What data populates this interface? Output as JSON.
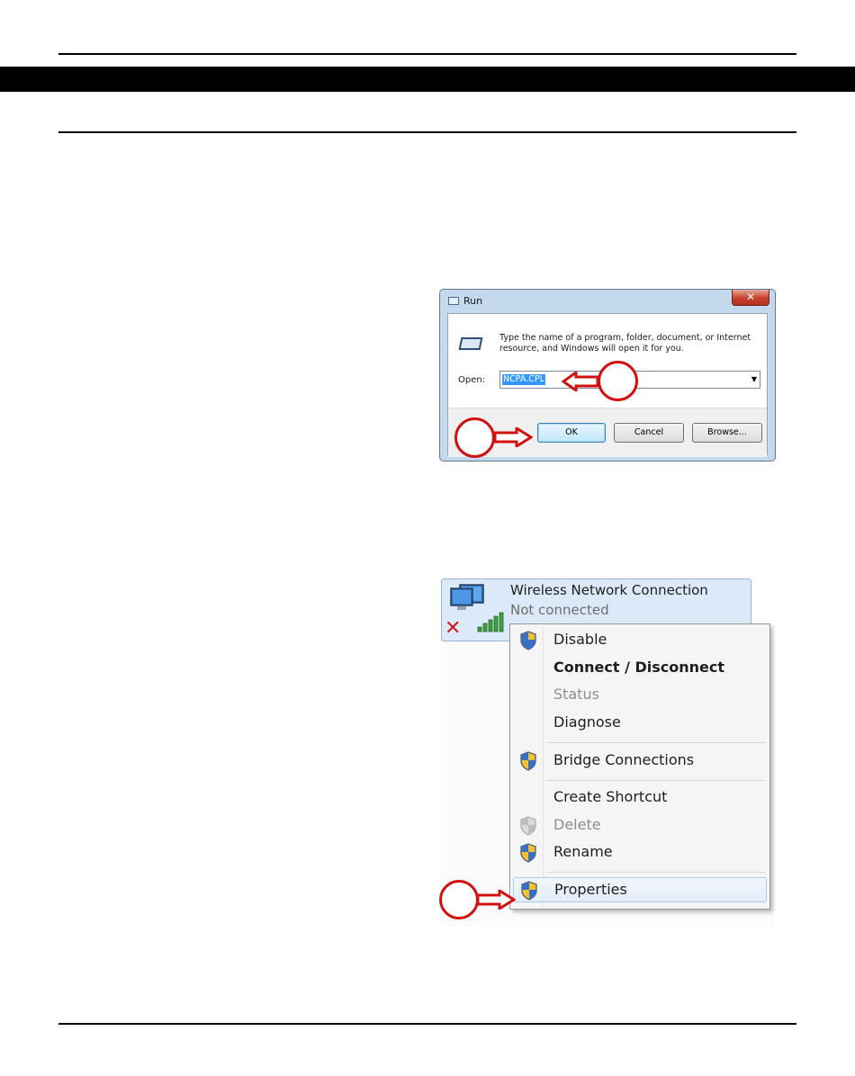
{
  "run_dialog": {
    "title": "Run",
    "description": "Type the name of a program, folder, document, or Internet resource, and Windows will open it for you.",
    "open_label": "Open:",
    "open_value": "NCPA.CPL",
    "buttons": {
      "ok": "OK",
      "cancel": "Cancel",
      "browse": "Browse..."
    },
    "icons": {
      "title": "run-icon",
      "app": "run-program-icon",
      "close": "close-icon",
      "dropdown": "chevron-down-icon"
    }
  },
  "network": {
    "connection_name": "Wireless Network Connection",
    "connection_status": "Not connected",
    "icons": {
      "adapter": "network-adapter-icon",
      "status": "red-x-icon",
      "signal": "signal-bars-icon"
    }
  },
  "context_menu": {
    "items": [
      {
        "label": "Disable",
        "style": "normal",
        "shield": "uac-shield-icon"
      },
      {
        "label": "Connect / Disconnect",
        "style": "bold",
        "shield": ""
      },
      {
        "label": "Status",
        "style": "disabled",
        "shield": ""
      },
      {
        "label": "Diagnose",
        "style": "normal",
        "shield": ""
      },
      {
        "label": "Bridge Connections",
        "style": "normal",
        "shield": "uac-shield-icon"
      },
      {
        "label": "Create Shortcut",
        "style": "normal",
        "shield": ""
      },
      {
        "label": "Delete",
        "style": "disabled",
        "shield": "uac-shield-disabled-icon"
      },
      {
        "label": "Rename",
        "style": "normal",
        "shield": "uac-shield-icon"
      },
      {
        "label": "Properties",
        "style": "hover",
        "shield": "uac-shield-icon"
      }
    ]
  },
  "colors": {
    "callout": "#d21010",
    "selection": "#3399ff",
    "menu_hover_border": "#aecbec"
  }
}
